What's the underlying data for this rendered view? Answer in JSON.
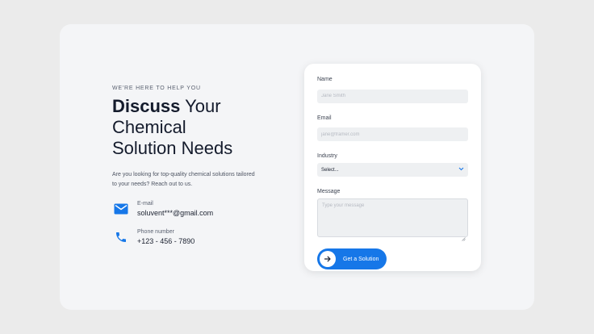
{
  "hero": {
    "eyebrow": "WE'RE HERE TO HELP YOU",
    "heading_bold": "Discuss",
    "heading_rest_1": "Your",
    "heading_line_2": "Chemical",
    "heading_line_3": "Solution Needs",
    "description": "Are you looking for top-quality chemical solutions tailored to your needs? Reach out to us."
  },
  "contacts": {
    "email": {
      "icon": "mail-icon",
      "label": "E-mail",
      "value": "soluvent***@gmail.com"
    },
    "phone": {
      "icon": "phone-icon",
      "label": "Phone number",
      "value": "+123 - 456 - 7890"
    }
  },
  "form": {
    "name": {
      "label": "Name",
      "placeholder": "Jane Smith",
      "value": ""
    },
    "email": {
      "label": "Email",
      "placeholder": "jane@framer.com",
      "value": ""
    },
    "industry": {
      "label": "Industry",
      "selected": "Select..."
    },
    "message": {
      "label": "Message",
      "placeholder": "Type your message",
      "value": ""
    },
    "submit": {
      "label": "Get a Solution",
      "icon": "arrow-right-icon"
    }
  },
  "colors": {
    "accent": "#1677e8",
    "background": "#ebebeb",
    "card": "#f4f5f7",
    "field": "#eef0f2"
  }
}
